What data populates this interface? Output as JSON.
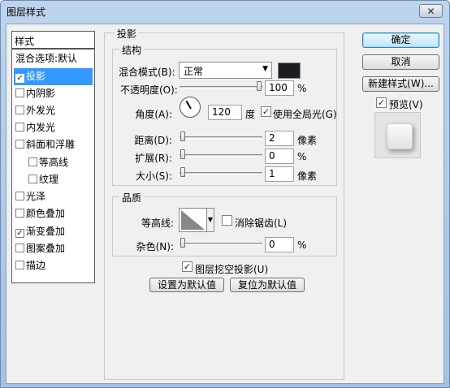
{
  "window": {
    "title": "图层样式",
    "close_glyph": "✕"
  },
  "styles_list": {
    "header": "样式",
    "items": [
      {
        "label": "混合选项:默认",
        "checkbox": false
      },
      {
        "label": "投影",
        "checkbox": true,
        "checked": true,
        "selected": true
      },
      {
        "label": "内阴影",
        "checkbox": true,
        "checked": false
      },
      {
        "label": "外发光",
        "checkbox": true,
        "checked": false
      },
      {
        "label": "内发光",
        "checkbox": true,
        "checked": false
      },
      {
        "label": "斜面和浮雕",
        "checkbox": true,
        "checked": false
      },
      {
        "label": "等高线",
        "checkbox": true,
        "checked": false,
        "indent": true
      },
      {
        "label": "纹理",
        "checkbox": true,
        "checked": false,
        "indent": true
      },
      {
        "label": "光泽",
        "checkbox": true,
        "checked": false
      },
      {
        "label": "颜色叠加",
        "checkbox": true,
        "checked": false
      },
      {
        "label": "渐变叠加",
        "checkbox": true,
        "checked": true
      },
      {
        "label": "图案叠加",
        "checkbox": true,
        "checked": false
      },
      {
        "label": "描边",
        "checkbox": true,
        "checked": false
      }
    ]
  },
  "drop_shadow": {
    "section_title": "投影",
    "structure": {
      "title": "结构",
      "blend_mode_label": "混合模式(B):",
      "blend_mode_value": "正常",
      "shadow_color": "#1a1d22",
      "opacity_label": "不透明度(O):",
      "opacity_value": "100",
      "opacity_unit": "%",
      "angle_label": "角度(A):",
      "angle_value": "120",
      "angle_unit": "度",
      "global_light_label": "使用全局光(G)",
      "global_light_checked": true,
      "distance_label": "距离(D):",
      "distance_value": "2",
      "distance_unit": "像素",
      "spread_label": "扩展(R):",
      "spread_value": "0",
      "spread_unit": "%",
      "size_label": "大小(S):",
      "size_value": "1",
      "size_unit": "像素"
    },
    "quality": {
      "title": "品质",
      "contour_label": "等高线:",
      "anti_alias_label": "消除锯齿(L)",
      "anti_alias_checked": false,
      "noise_label": "杂色(N):",
      "noise_value": "0",
      "noise_unit": "%"
    },
    "knockout_label": "图层挖空投影(U)",
    "knockout_checked": true,
    "make_default_button": "设置为默认值",
    "reset_default_button": "复位为默认值"
  },
  "buttons": {
    "ok": "确定",
    "cancel": "取消",
    "new_style": "新建样式(W)...",
    "preview_label": "预览(V)",
    "preview_checked": true
  },
  "check_glyph": "✓",
  "dropdown_glyph": "▼"
}
